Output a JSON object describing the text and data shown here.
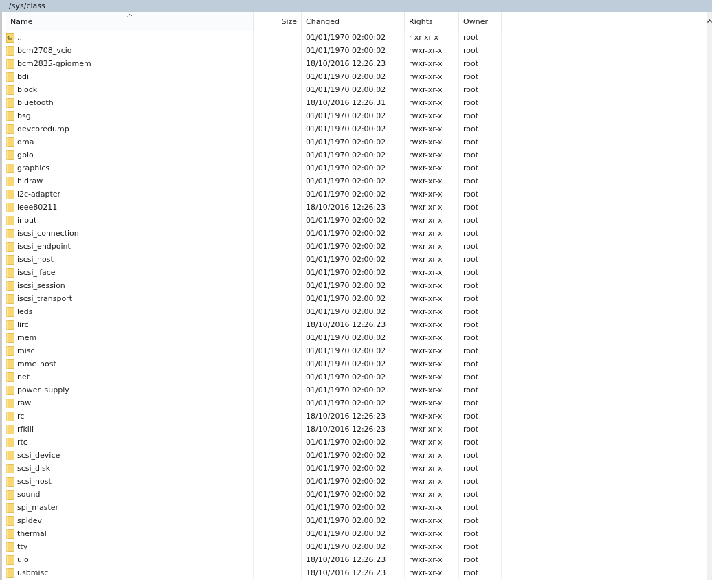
{
  "path_bar": {
    "path": "/sys/class"
  },
  "columns": [
    {
      "label": "Name",
      "sorted": true
    },
    {
      "label": "Size",
      "sorted": false
    },
    {
      "label": "Changed",
      "sorted": false
    },
    {
      "label": "Rights",
      "sorted": false
    },
    {
      "label": "Owner",
      "sorted": false
    }
  ],
  "rows": [
    {
      "kind": "parent",
      "name": "..",
      "changed": "01/01/1970 02:00:02",
      "rights": "r-xr-xr-x",
      "owner": "root"
    },
    {
      "kind": "folder",
      "name": "bcm2708_vcio",
      "changed": "01/01/1970 02:00:02",
      "rights": "rwxr-xr-x",
      "owner": "root"
    },
    {
      "kind": "folder",
      "name": "bcm2835-gpiomem",
      "changed": "18/10/2016 12:26:23",
      "rights": "rwxr-xr-x",
      "owner": "root"
    },
    {
      "kind": "folder",
      "name": "bdi",
      "changed": "01/01/1970 02:00:02",
      "rights": "rwxr-xr-x",
      "owner": "root"
    },
    {
      "kind": "folder",
      "name": "block",
      "changed": "01/01/1970 02:00:02",
      "rights": "rwxr-xr-x",
      "owner": "root"
    },
    {
      "kind": "folder",
      "name": "bluetooth",
      "changed": "18/10/2016 12:26:31",
      "rights": "rwxr-xr-x",
      "owner": "root"
    },
    {
      "kind": "folder",
      "name": "bsg",
      "changed": "01/01/1970 02:00:02",
      "rights": "rwxr-xr-x",
      "owner": "root"
    },
    {
      "kind": "folder",
      "name": "devcoredump",
      "changed": "01/01/1970 02:00:02",
      "rights": "rwxr-xr-x",
      "owner": "root"
    },
    {
      "kind": "folder",
      "name": "dma",
      "changed": "01/01/1970 02:00:02",
      "rights": "rwxr-xr-x",
      "owner": "root"
    },
    {
      "kind": "folder",
      "name": "gpio",
      "changed": "01/01/1970 02:00:02",
      "rights": "rwxr-xr-x",
      "owner": "root"
    },
    {
      "kind": "folder",
      "name": "graphics",
      "changed": "01/01/1970 02:00:02",
      "rights": "rwxr-xr-x",
      "owner": "root"
    },
    {
      "kind": "folder",
      "name": "hidraw",
      "changed": "01/01/1970 02:00:02",
      "rights": "rwxr-xr-x",
      "owner": "root"
    },
    {
      "kind": "folder",
      "name": "i2c-adapter",
      "changed": "01/01/1970 02:00:02",
      "rights": "rwxr-xr-x",
      "owner": "root"
    },
    {
      "kind": "folder",
      "name": "ieee80211",
      "changed": "18/10/2016 12:26:23",
      "rights": "rwxr-xr-x",
      "owner": "root"
    },
    {
      "kind": "folder",
      "name": "input",
      "changed": "01/01/1970 02:00:02",
      "rights": "rwxr-xr-x",
      "owner": "root"
    },
    {
      "kind": "folder",
      "name": "iscsi_connection",
      "changed": "01/01/1970 02:00:02",
      "rights": "rwxr-xr-x",
      "owner": "root"
    },
    {
      "kind": "folder",
      "name": "iscsi_endpoint",
      "changed": "01/01/1970 02:00:02",
      "rights": "rwxr-xr-x",
      "owner": "root"
    },
    {
      "kind": "folder",
      "name": "iscsi_host",
      "changed": "01/01/1970 02:00:02",
      "rights": "rwxr-xr-x",
      "owner": "root"
    },
    {
      "kind": "folder",
      "name": "iscsi_iface",
      "changed": "01/01/1970 02:00:02",
      "rights": "rwxr-xr-x",
      "owner": "root"
    },
    {
      "kind": "folder",
      "name": "iscsi_session",
      "changed": "01/01/1970 02:00:02",
      "rights": "rwxr-xr-x",
      "owner": "root"
    },
    {
      "kind": "folder",
      "name": "iscsi_transport",
      "changed": "01/01/1970 02:00:02",
      "rights": "rwxr-xr-x",
      "owner": "root"
    },
    {
      "kind": "folder",
      "name": "leds",
      "changed": "01/01/1970 02:00:02",
      "rights": "rwxr-xr-x",
      "owner": "root"
    },
    {
      "kind": "folder",
      "name": "lirc",
      "changed": "18/10/2016 12:26:23",
      "rights": "rwxr-xr-x",
      "owner": "root"
    },
    {
      "kind": "folder",
      "name": "mem",
      "changed": "01/01/1970 02:00:02",
      "rights": "rwxr-xr-x",
      "owner": "root"
    },
    {
      "kind": "folder",
      "name": "misc",
      "changed": "01/01/1970 02:00:02",
      "rights": "rwxr-xr-x",
      "owner": "root"
    },
    {
      "kind": "folder",
      "name": "mmc_host",
      "changed": "01/01/1970 02:00:02",
      "rights": "rwxr-xr-x",
      "owner": "root"
    },
    {
      "kind": "folder",
      "name": "net",
      "changed": "01/01/1970 02:00:02",
      "rights": "rwxr-xr-x",
      "owner": "root"
    },
    {
      "kind": "folder",
      "name": "power_supply",
      "changed": "01/01/1970 02:00:02",
      "rights": "rwxr-xr-x",
      "owner": "root"
    },
    {
      "kind": "folder",
      "name": "raw",
      "changed": "01/01/1970 02:00:02",
      "rights": "rwxr-xr-x",
      "owner": "root"
    },
    {
      "kind": "folder",
      "name": "rc",
      "changed": "18/10/2016 12:26:23",
      "rights": "rwxr-xr-x",
      "owner": "root"
    },
    {
      "kind": "folder",
      "name": "rfkill",
      "changed": "18/10/2016 12:26:23",
      "rights": "rwxr-xr-x",
      "owner": "root"
    },
    {
      "kind": "folder",
      "name": "rtc",
      "changed": "01/01/1970 02:00:02",
      "rights": "rwxr-xr-x",
      "owner": "root"
    },
    {
      "kind": "folder",
      "name": "scsi_device",
      "changed": "01/01/1970 02:00:02",
      "rights": "rwxr-xr-x",
      "owner": "root"
    },
    {
      "kind": "folder",
      "name": "scsi_disk",
      "changed": "01/01/1970 02:00:02",
      "rights": "rwxr-xr-x",
      "owner": "root"
    },
    {
      "kind": "folder",
      "name": "scsi_host",
      "changed": "01/01/1970 02:00:02",
      "rights": "rwxr-xr-x",
      "owner": "root"
    },
    {
      "kind": "folder",
      "name": "sound",
      "changed": "01/01/1970 02:00:02",
      "rights": "rwxr-xr-x",
      "owner": "root"
    },
    {
      "kind": "folder",
      "name": "spi_master",
      "changed": "01/01/1970 02:00:02",
      "rights": "rwxr-xr-x",
      "owner": "root"
    },
    {
      "kind": "folder",
      "name": "spidev",
      "changed": "01/01/1970 02:00:02",
      "rights": "rwxr-xr-x",
      "owner": "root"
    },
    {
      "kind": "folder",
      "name": "thermal",
      "changed": "01/01/1970 02:00:02",
      "rights": "rwxr-xr-x",
      "owner": "root"
    },
    {
      "kind": "folder",
      "name": "tty",
      "changed": "01/01/1970 02:00:02",
      "rights": "rwxr-xr-x",
      "owner": "root"
    },
    {
      "kind": "folder",
      "name": "uio",
      "changed": "18/10/2016 12:26:23",
      "rights": "rwxr-xr-x",
      "owner": "root"
    },
    {
      "kind": "folder",
      "name": "usbmisc",
      "changed": "18/10/2016 12:26:23",
      "rights": "rwxr-xr-x",
      "owner": "root"
    }
  ]
}
